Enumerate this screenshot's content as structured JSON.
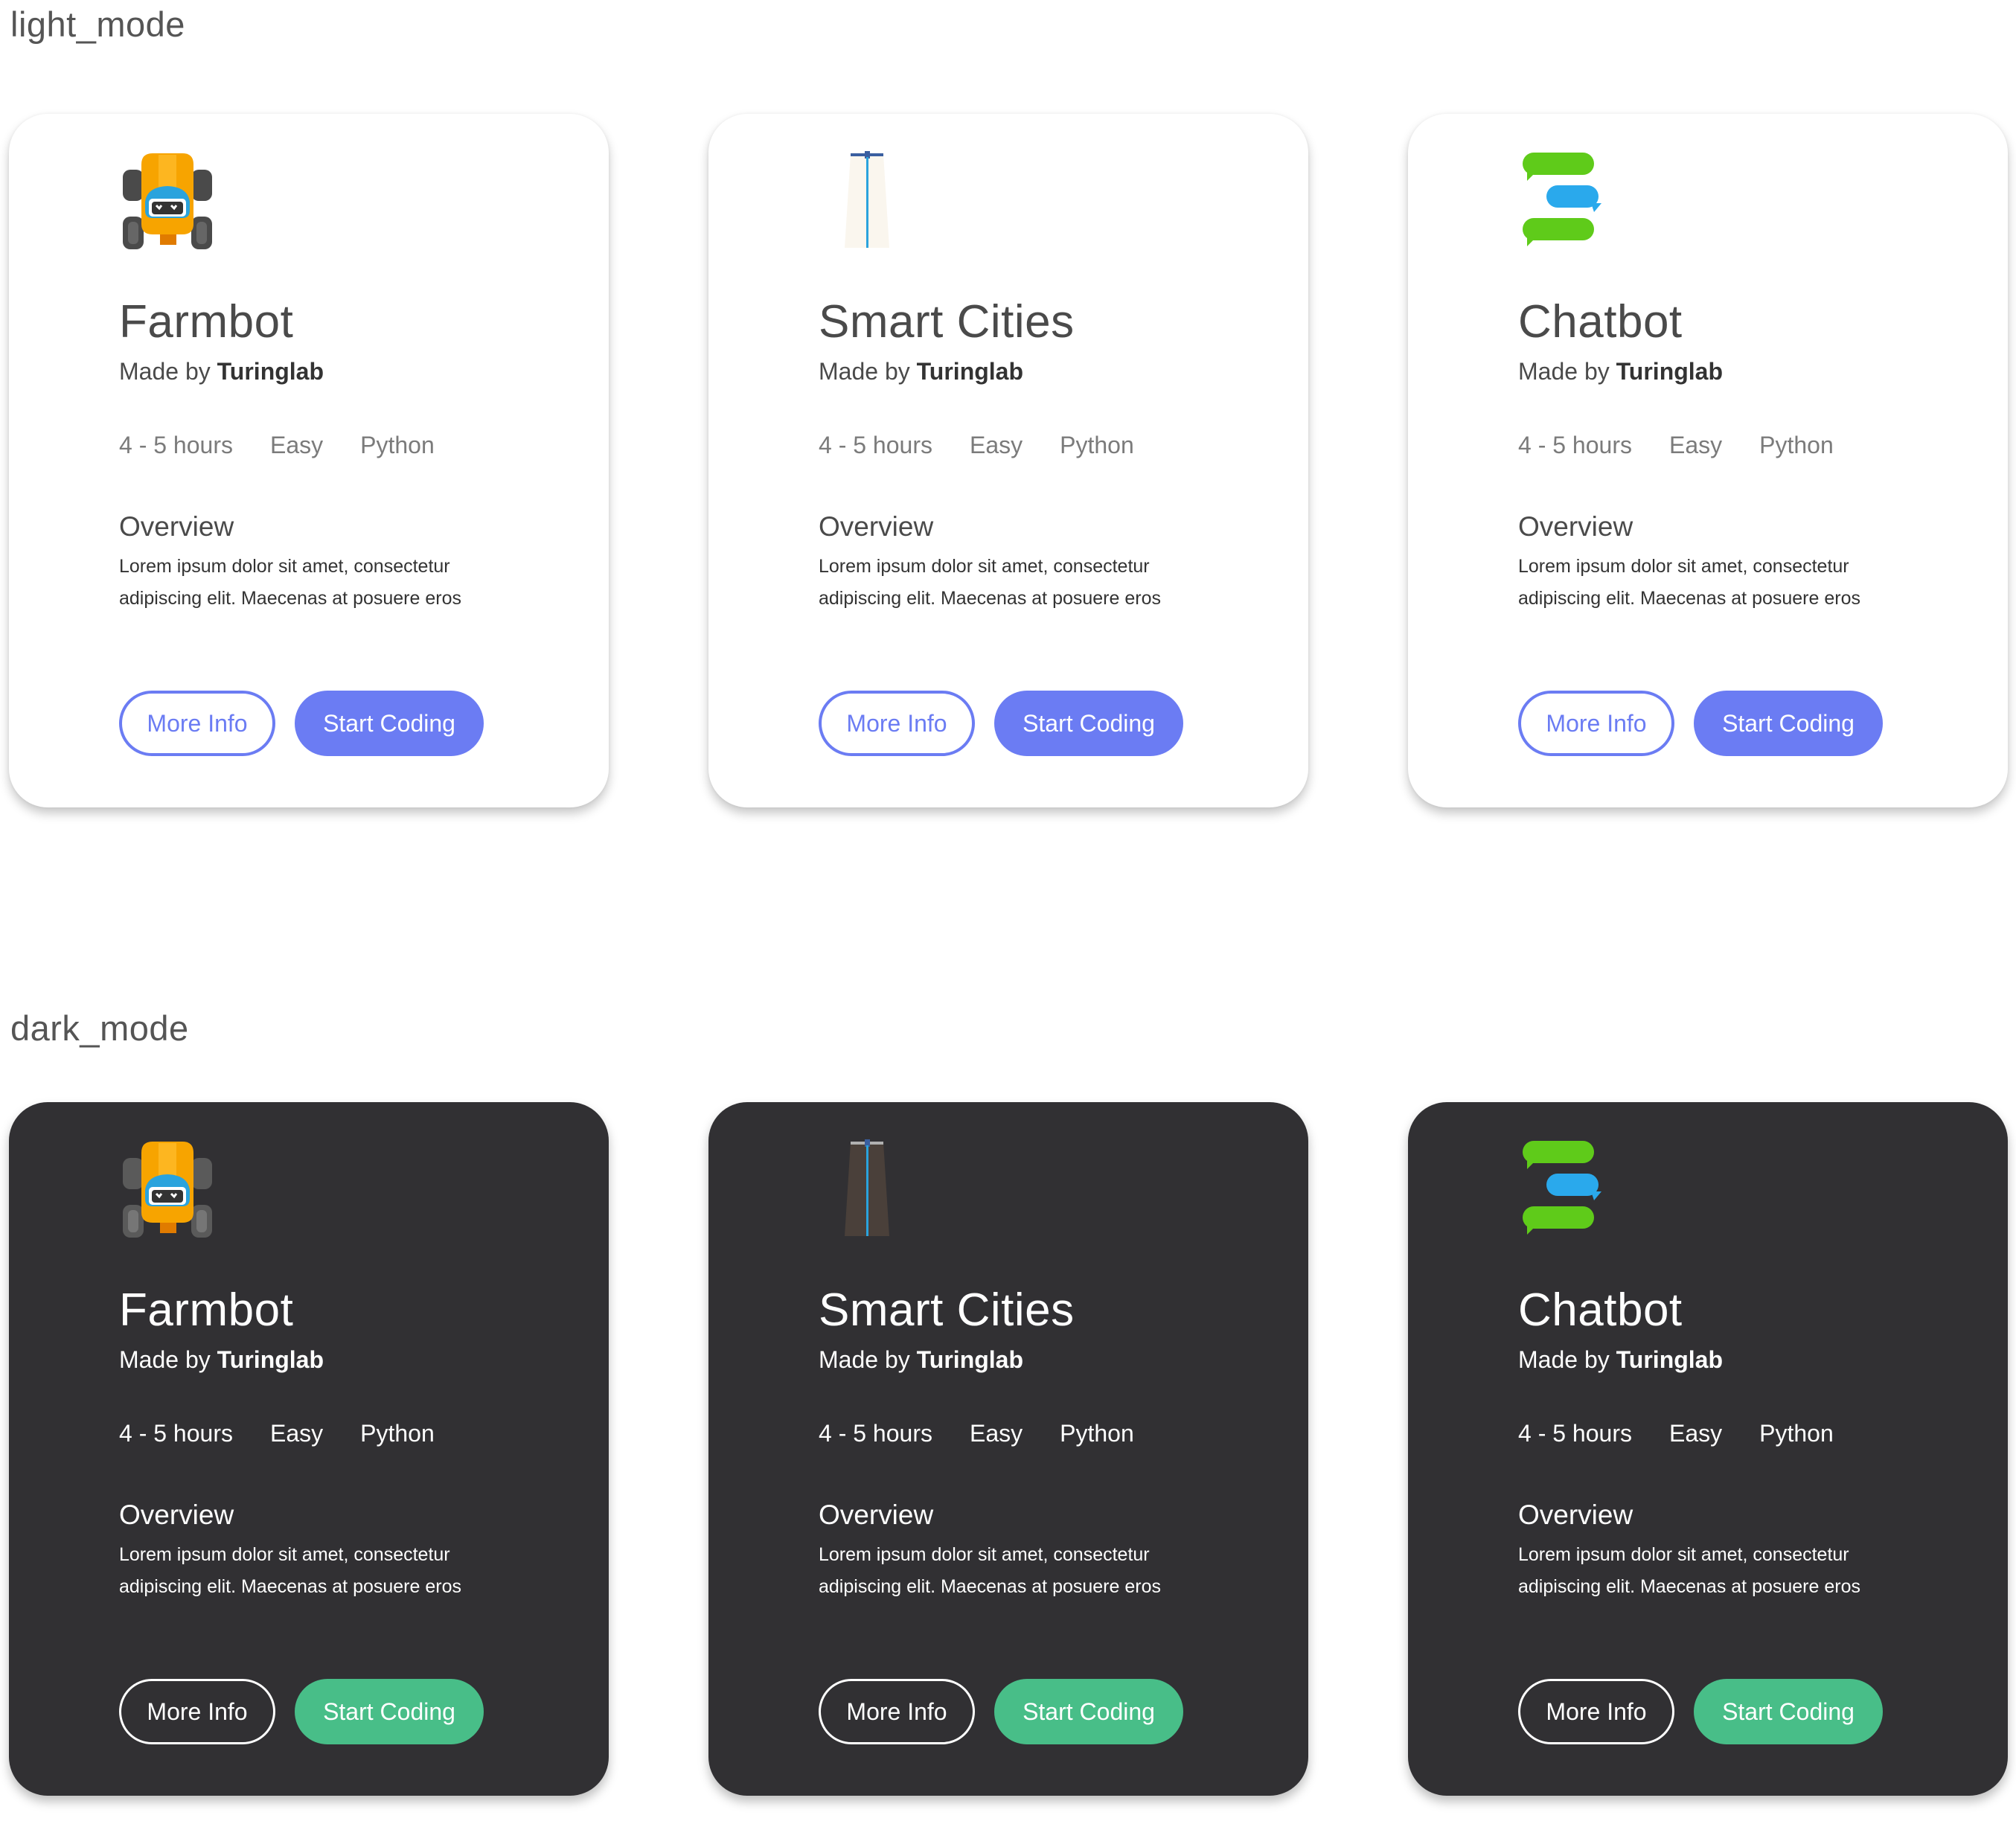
{
  "sections": {
    "light_label": "light_mode",
    "dark_label": "dark_mode"
  },
  "colors": {
    "light_accent": "#6b7cf3",
    "dark_accent": "#48be88",
    "dark_card_bg": "#313033"
  },
  "light": {
    "cards": [
      {
        "icon": "farmbot-robot-icon",
        "title": "Farmbot",
        "made_by_prefix": "Made by",
        "made_by_name": "Turinglab",
        "duration": "4 - 5 hours",
        "difficulty": "Easy",
        "language": "Python",
        "overview_title": "Overview",
        "overview_text": "Lorem ipsum dolor sit amet, consectetur adipiscing elit. Maecenas at posuere eros",
        "more_info": "More Info",
        "start_coding": "Start Coding"
      },
      {
        "icon": "smart-cities-road-icon",
        "title": "Smart Cities",
        "made_by_prefix": "Made by",
        "made_by_name": "Turinglab",
        "duration": "4 - 5 hours",
        "difficulty": "Easy",
        "language": "Python",
        "overview_title": "Overview",
        "overview_text": "Lorem ipsum dolor sit amet, consectetur adipiscing elit. Maecenas at posuere eros",
        "more_info": "More Info",
        "start_coding": "Start Coding"
      },
      {
        "icon": "chat-bubbles-icon",
        "title": "Chatbot",
        "made_by_prefix": "Made by",
        "made_by_name": "Turinglab",
        "duration": "4 - 5 hours",
        "difficulty": "Easy",
        "language": "Python",
        "overview_title": "Overview",
        "overview_text": "Lorem ipsum dolor sit amet, consectetur adipiscing elit. Maecenas at posuere eros",
        "more_info": "More Info",
        "start_coding": "Start Coding"
      }
    ]
  },
  "dark": {
    "cards": [
      {
        "icon": "farmbot-robot-icon",
        "title": "Farmbot",
        "made_by_prefix": "Made by",
        "made_by_name": "Turinglab",
        "duration": "4 - 5 hours",
        "difficulty": "Easy",
        "language": "Python",
        "overview_title": "Overview",
        "overview_text": "Lorem ipsum dolor sit amet, consectetur adipiscing elit. Maecenas at posuere eros",
        "more_info": "More Info",
        "start_coding": "Start Coding"
      },
      {
        "icon": "smart-cities-road-icon",
        "title": "Smart Cities",
        "made_by_prefix": "Made by",
        "made_by_name": "Turinglab",
        "duration": "4 - 5 hours",
        "difficulty": "Easy",
        "language": "Python",
        "overview_title": "Overview",
        "overview_text": "Lorem ipsum dolor sit amet, consectetur adipiscing elit. Maecenas at posuere eros",
        "more_info": "More Info",
        "start_coding": "Start Coding"
      },
      {
        "icon": "chat-bubbles-icon",
        "title": "Chatbot",
        "made_by_prefix": "Made by",
        "made_by_name": "Turinglab",
        "duration": "4 - 5 hours",
        "difficulty": "Easy",
        "language": "Python",
        "overview_title": "Overview",
        "overview_text": "Lorem ipsum dolor sit amet, consectetur adipiscing elit. Maecenas at posuere eros",
        "more_info": "More Info",
        "start_coding": "Start Coding"
      }
    ]
  }
}
